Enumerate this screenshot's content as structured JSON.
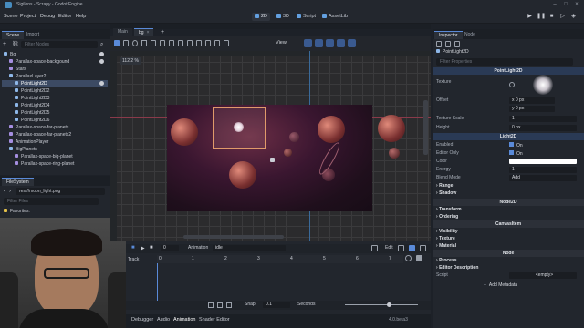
{
  "app": {
    "title": "Sigilons - Scrapy - Godot Engine",
    "menus": [
      "Scene",
      "Project",
      "Debug",
      "Editor",
      "Help"
    ],
    "workspaces": [
      "2D",
      "3D",
      "Script",
      "AssetLib"
    ]
  },
  "scene_dock": {
    "tabs": [
      "Scene",
      "Import"
    ],
    "filter_placeholder": "Filter Nodes",
    "nodes": [
      {
        "label": "Bg",
        "color": "#8eb7e8"
      },
      {
        "label": "Parallax-space-backgound",
        "color": "#a58ee0"
      },
      {
        "label": "Stars",
        "color": "#a58ee0"
      },
      {
        "label": "ParallaxLayer2",
        "color": "#8eb7e8"
      },
      {
        "label": "PointLight2D",
        "color": "#8eb7e8"
      },
      {
        "label": "PointLight2D2",
        "color": "#8eb7e8"
      },
      {
        "label": "PointLight2D3",
        "color": "#8eb7e8"
      },
      {
        "label": "PointLight2D4",
        "color": "#8eb7e8"
      },
      {
        "label": "PointLight2D5",
        "color": "#8eb7e8"
      },
      {
        "label": "PointLight2D6",
        "color": "#8eb7e8"
      },
      {
        "label": "Parallax-space-far-planets",
        "color": "#a58ee0"
      },
      {
        "label": "Parallax-space-far-planets2",
        "color": "#a58ee0"
      },
      {
        "label": "AnimationPlayer",
        "color": "#a58ee0"
      },
      {
        "label": "BigPlanets",
        "color": "#8eb7e8"
      },
      {
        "label": "Parallax-space-big-planet",
        "color": "#a58ee0"
      },
      {
        "label": "Parallax-space-ring-planet",
        "color": "#a58ee0"
      }
    ],
    "selected_index": 4
  },
  "filesystem_dock": {
    "tab": "FileSystem",
    "path": "res://moon_light.png",
    "filter_placeholder": "Filter Files",
    "favorites_label": "Favorites:"
  },
  "editor_tabs": {
    "items": [
      "Main",
      "bg"
    ],
    "active": "bg"
  },
  "viewport": {
    "zoom_label": "112.2 %",
    "view_menu": "View"
  },
  "animation_panel": {
    "animation_label": "Animation",
    "current_animation": "idle",
    "edit_label": "Edit",
    "frame_value": "0",
    "track_label": "Track",
    "timeline_ticks": [
      "0",
      "1",
      "2",
      "3",
      "4",
      "5",
      "6",
      "7"
    ],
    "snap_label": "Snap:",
    "snap_value": "0.1",
    "seconds_label": "Seconds",
    "bottom_tabs": [
      "Debugger",
      "Audio",
      "Animation",
      "Shader Editor"
    ],
    "version": "4.0.beta3"
  },
  "inspector": {
    "tabs": [
      "Inspector",
      "Node"
    ],
    "object_name": "PointLight2D",
    "filter_placeholder": "Filter Properties",
    "class_header": "PointLight2D",
    "props": [
      {
        "label": "Texture",
        "value": ""
      },
      {
        "label": "Offset",
        "value": "x 0 px"
      },
      {
        "label": "",
        "value": "y 0 px"
      },
      {
        "label": "Texture Scale",
        "value": "1"
      },
      {
        "label": "Height",
        "value": "0 px"
      }
    ],
    "light2d_header": "Light2D",
    "light_props": [
      {
        "label": "Enabled",
        "value": "On"
      },
      {
        "label": "Editor Only",
        "value": "On"
      },
      {
        "label": "Color",
        "value": ""
      },
      {
        "label": "Energy",
        "value": "1"
      },
      {
        "label": "Blend Mode",
        "value": "Add"
      }
    ],
    "subsections": [
      "Range",
      "Shadow"
    ],
    "node2d_header": "Node2D",
    "node2d_sub": [
      "Transform",
      "Ordering"
    ],
    "canvas_header": "CanvasItem",
    "canvas_sub": [
      "Visibility",
      "Texture",
      "Material"
    ],
    "node_header": "Node",
    "node_sub": [
      "Process",
      "Editor Description"
    ],
    "script_label": "Script",
    "script_value": "<empty>",
    "add_metadata": "Add Metadata"
  }
}
